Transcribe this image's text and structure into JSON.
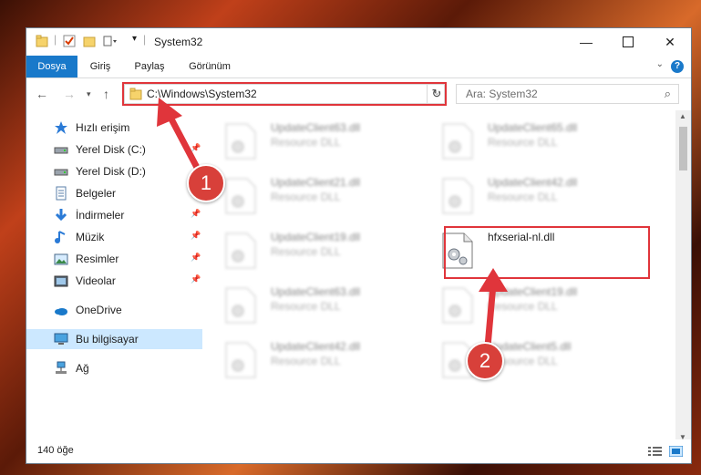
{
  "window": {
    "title": "System32"
  },
  "ribbon": {
    "tabs": [
      {
        "label": "Dosya",
        "active": true
      },
      {
        "label": "Giriş",
        "active": false
      },
      {
        "label": "Paylaş",
        "active": false
      },
      {
        "label": "Görünüm",
        "active": false
      }
    ],
    "help_label": "?"
  },
  "navigation": {
    "address": "C:\\Windows\\System32",
    "search_placeholder": "Ara: System32"
  },
  "sidebar": {
    "items": [
      {
        "label": "Hızlı erişim",
        "icon": "star-icon",
        "pinned": false
      },
      {
        "label": "Yerel Disk (C:)",
        "icon": "drive-icon",
        "pinned": true
      },
      {
        "label": "Yerel Disk (D:)",
        "icon": "drive-icon",
        "pinned": false
      },
      {
        "label": "Belgeler",
        "icon": "documents-icon",
        "pinned": true
      },
      {
        "label": "İndirmeler",
        "icon": "download-icon",
        "pinned": true
      },
      {
        "label": "Müzik",
        "icon": "music-icon",
        "pinned": true
      },
      {
        "label": "Resimler",
        "icon": "pictures-icon",
        "pinned": true
      },
      {
        "label": "Videolar",
        "icon": "videos-icon",
        "pinned": true
      },
      {
        "label": "OneDrive",
        "icon": "onedrive-icon",
        "pinned": false
      },
      {
        "label": "Bu bilgisayar",
        "icon": "computer-icon",
        "pinned": false,
        "selected": true
      },
      {
        "label": "Ağ",
        "icon": "network-icon",
        "pinned": false
      }
    ]
  },
  "files": [
    {
      "name": "UpdateClient63.dll",
      "type": "Resource DLL",
      "blurred": true
    },
    {
      "name": "UpdateClient65.dll",
      "type": "Resource DLL",
      "blurred": true
    },
    {
      "name": "UpdateClient21.dll",
      "type": "Resource DLL",
      "blurred": true
    },
    {
      "name": "UpdateClient42.dll",
      "type": "Resource DLL",
      "blurred": true
    },
    {
      "name": "UpdateClient19.dll",
      "type": "Resource DLL",
      "blurred": true
    },
    {
      "name": "hfxserial-nl.dll",
      "type": "",
      "blurred": false
    },
    {
      "name": "UpdateClient63.dll",
      "type": "Resource DLL",
      "blurred": true
    },
    {
      "name": "UpdateClient19.dll",
      "type": "Resource DLL",
      "blurred": true
    },
    {
      "name": "UpdateClient42.dll",
      "type": "Resource DLL",
      "blurred": true
    },
    {
      "name": "UpdateClient5.dll",
      "type": "Resource DLL",
      "blurred": true
    }
  ],
  "status": {
    "item_count": "140 öğe"
  },
  "annotations": {
    "step1": "1",
    "step2": "2"
  },
  "colors": {
    "accent": "#1979ca",
    "highlight": "#e0353b",
    "selected": "#cce8ff"
  }
}
